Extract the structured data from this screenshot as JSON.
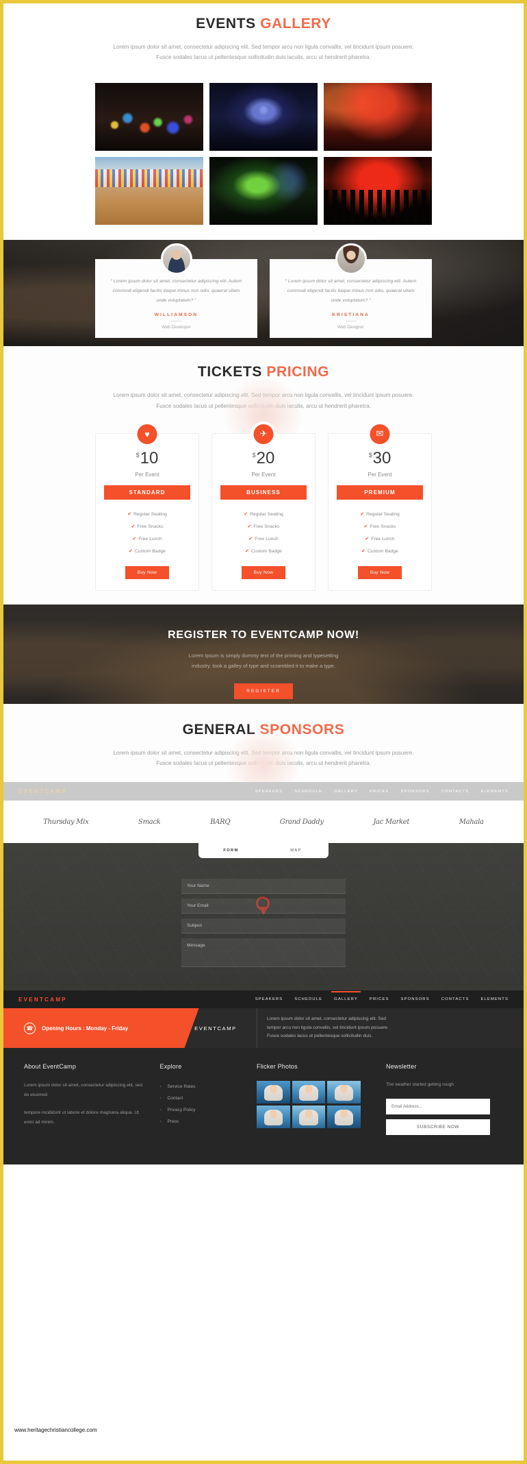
{
  "gallery": {
    "title_main": "EVENTS",
    "title_accent": "GALLERY",
    "sub_line1": "Lorem ipsum dolor sit amet, consectetur adipiscing elit. Sed tempor arcu non ligula convallis, vel tincidunt ipsum posuere.",
    "sub_line2": "Fusce sodales lacus ut pellentesque sollicitudin duis iaculis, arcu ut hendrerit pharetra.",
    "items": [
      {
        "name": "concert-stage-lights"
      },
      {
        "name": "blue-stage-rig"
      },
      {
        "name": "red-concert-crowd"
      },
      {
        "name": "motocross-race"
      },
      {
        "name": "green-stage-show"
      },
      {
        "name": "crowd-hands-red-lights"
      }
    ]
  },
  "testimonials": [
    {
      "quote": "“ Lorem ipsum dolor sit amet, consectetur adipiscing elit. Autem commodi eligendi facilis itaque minus non odio, quaerat ullam unde voluptatum? ”",
      "name": "WILLIAMSON",
      "role": "Web Developer",
      "avatar": "male-avatar"
    },
    {
      "quote": "“ Lorem ipsum dolor sit amet, consectetur adipiscing elit. Autem commodi eligendi facilis itaque minus non odio, quaerat ullam unde voluptatum? ”",
      "name": "KRISTIANA",
      "role": "Web Designer",
      "avatar": "female-avatar"
    }
  ],
  "pricing": {
    "title_main": "TICKETS",
    "title_accent": "PRICING",
    "sub_line1": "Lorem ipsum dolor sit amet, consectetur adipiscing elit. Sed tempor arcu non ligula convallis, vel tincidunt ipsum posuere.",
    "sub_line2": "Fusce sodales lacus ut pellentesque sollicitudin duis iaculis, arcu ut hendrerit pharetra.",
    "plans": [
      {
        "icon": "♥",
        "icon_name": "heart-badge-icon",
        "currency": "$",
        "amount": "10",
        "period": "Per Event",
        "tag": "STANDARD",
        "features": [
          "Regular Seating",
          "Free Snacks",
          "Free Lunch",
          "Custom Badge"
        ],
        "buy_label": "Buy Now"
      },
      {
        "icon": "✈",
        "icon_name": "plane-badge-icon",
        "currency": "$",
        "amount": "20",
        "period": "Per Event",
        "tag": "BUSINESS",
        "features": [
          "Regular Seating",
          "Free Snacks",
          "Free Lunch",
          "Custom Badge"
        ],
        "buy_label": "Buy Now"
      },
      {
        "icon": "✉",
        "icon_name": "briefcase-badge-icon",
        "currency": "$",
        "amount": "30",
        "period": "Per Event",
        "tag": "PREMIUM",
        "features": [
          "Regular Seating",
          "Free Snacks",
          "Free Lunch",
          "Custom Badge"
        ],
        "buy_label": "Buy Now"
      }
    ]
  },
  "register": {
    "title": "REGISTER TO EVENTCAMP NOW!",
    "line1": "Lorem Ipsum is simply dummy text of the printing and typesetting",
    "line2": "industry. took a galley of type and scrambled it to make a type.",
    "button": "REGISTER"
  },
  "sponsors": {
    "title_main": "GENERAL",
    "title_accent": "SPONSORS",
    "sub_line1": "Lorem ipsum dolor sit amet, consectetur adipiscing elit. Sed tempor arcu non ligula convallis, vel tincidunt ipsum posuere.",
    "sub_line2": "Fusce sodales lacus ut pellentesque sollicitudin duis iaculis, arcu ut hendrerit pharetra.",
    "logos": [
      "Thursday Mix",
      "Smack",
      "BARQ",
      "Grand Daddy",
      "Jac Market",
      "Mahala"
    ]
  },
  "sticky_nav": {
    "brand": "EVENTCAMP",
    "items": [
      "SPEAKERS",
      "SCHEDULE",
      "GALLERY",
      "PRICES",
      "SPONSORS",
      "CONTACTS",
      "ELEMENTS"
    ]
  },
  "footer_nav": {
    "brand": "EVENTCAMP",
    "items": [
      "SPEAKERS",
      "SCHEDULE",
      "GALLERY",
      "PRICES",
      "SPONSORS",
      "CONTACTS",
      "ELEMENTS"
    ],
    "active": "GALLERY"
  },
  "contact": {
    "tabs": [
      "FORM",
      "MAP"
    ],
    "active_tab": "FORM",
    "fields": {
      "name_placeholder": "Your Name",
      "email_placeholder": "Your Email",
      "subject_placeholder": "Subject",
      "message_placeholder": "Message"
    }
  },
  "hours": {
    "icon": "☎",
    "text": "Opening Hours : Monday - Friday",
    "brand": "EVENTCAMP",
    "desc_line1": "Lorem ipsum dolor sit amet, consectetur adipiscing elit. Sed",
    "desc_line2": "tempor arcu non ligula convallis, vel tincidunt ipsum posuere.",
    "desc_line3": "Fusce sodales lacus ut pellentesque sollicitudin duis."
  },
  "footer": {
    "about": {
      "title": "About EventCamp",
      "p1": "Lorem ipsum dolor sit amet, consectetur adipiscing elit, sed do eiusmod",
      "p2": "tempore incididunt ut labore et dolore magnana aliqua. Ut enim ad minim."
    },
    "explore": {
      "title": "Explore",
      "items": [
        "Service Rates",
        "Contact",
        "Privacy Policy",
        "Press"
      ]
    },
    "flicker": {
      "title": "Flicker Photos",
      "thumbs": [
        "sailing-1",
        "sailing-2",
        "sailing-3",
        "sailing-4",
        "sailing-5",
        "sailing-6"
      ]
    },
    "newsletter": {
      "title": "Newsletter",
      "text": "The weather started getting rough",
      "placeholder": "Email Address...",
      "button": "SUBSCRIBE NOW"
    }
  },
  "watermark": "www.heritagechristiancollege.com"
}
